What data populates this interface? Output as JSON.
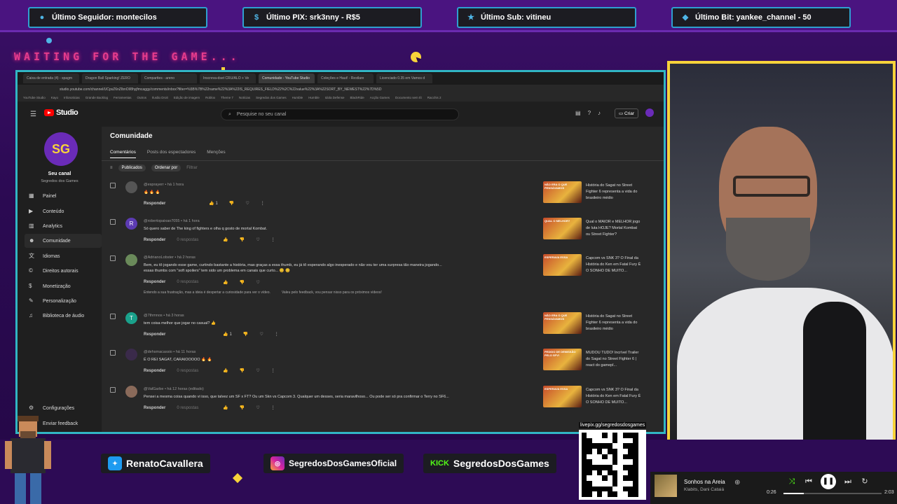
{
  "alerts": {
    "follower": "Último Seguidor: montecilos",
    "pix": "Último PIX: srk3nny - R$5",
    "sub": "Último Sub: vitineu",
    "bit": "Último Bit: yankee_channel - 50"
  },
  "waiting_text": "WAITING FOR THE GAME...",
  "browser": {
    "tabs": [
      "Caixa de entrada (4) - spagm",
      "Dragon Ball Sparking! ZERO",
      "Comparttes - areno",
      "Inscreva-dset CRU/ALO + Ve",
      "Comunidade - YouTube Studio",
      "Coleções e Haut! - Restlare",
      "Licenciado 0.35 em Vamos d"
    ],
    "url": "studio.youtube.com/channel/UCpsZ6nZIbnOl/8hyjfmcaggy/comments/inbox?filter=%5B%7B%22name%22%3A%22IS_REQUIRES_FIELD%22%2C%22value%22%3A%22SORT_BY_NEWEST%22%7D%5D",
    "bookmarks": [
      "YouTube Studio",
      "Kayo",
      "Infonoticias",
      "Grande Backlog",
      "Ferramentas",
      "Outros",
      "Ilusão Droit",
      "Edição de imagem",
      "Roblox",
      "Theme 7",
      "Notícias",
      "Segredos dos Games",
      "Humble",
      "Humble",
      "Idola Defense",
      "BlackRide",
      "Acção Games",
      "Documento sem tít",
      "Racchis 2"
    ]
  },
  "studio": {
    "logo_text": "Studio",
    "search_placeholder": "Pesquise no seu canal",
    "create_label": "Criar",
    "channel_name": "Seu canal",
    "channel_sub": "Segredos dos Games",
    "avatar_text": "SG",
    "nav": [
      "Painel",
      "Conteúdo",
      "Analytics",
      "Comunidade",
      "Idiomas",
      "Direitos autorais",
      "Monetização",
      "Personalização",
      "Biblioteca de áudio"
    ],
    "bottom_nav": [
      "Configurações",
      "Enviar feedback"
    ],
    "page_title": "Comunidade",
    "tabs": [
      "Comentários",
      "Posts dos espectadores",
      "Menções"
    ],
    "filters": {
      "published": "Publicados",
      "order": "Ordenar por",
      "filter": "Filtrar"
    }
  },
  "comments": [
    {
      "user": "@esprayerr",
      "time": "há 1 hora",
      "text": "🔥 🔥 🔥",
      "reply": "Responder",
      "replies": "",
      "likes": "1",
      "avatar": "",
      "video": "História do Sagat no Street Fighter 6 representa a vida do brasileiro médio"
    },
    {
      "user": "@robertopaixao7055",
      "time": "há 1 hora",
      "text": "Só quero saber de The king of fighters e olha q gosto de mortal Kombat.",
      "reply": "Responder",
      "replies": "0 respostas",
      "likes": "",
      "avatar": "R",
      "video": "Qual o MAIOR e MELHOR jogo de luta HOJE? Mortal Kombat ou Street Fighter?"
    },
    {
      "user": "@AdrianoLobster",
      "time": "há 2 horas",
      "text": "Bem, eu tô jogando esse game, curtindo bastante a história, mas graças a essa thumb, eu já tô esperando algo inesperado e não vou ter uma surpresa tão maneira jogando... essas thumbs com \"soft spoilers\" tem sido um problema em canais que curto... 😊 😊",
      "reply": "Responder",
      "replies": "0 respostas",
      "likes": "",
      "avatar": "",
      "video": "Capcom vs SNK 3? O Final da História do Ken em Fatal Fury É O SONHO DE MUITO..."
    },
    {
      "user": "@7thmnos",
      "time": "há 3 horas",
      "text": "tem coisa melhor que jogar no casual? 👍",
      "reply": "Responder",
      "replies": "",
      "likes": "1",
      "avatar": "T",
      "video": "História do Sagat no Street Fighter 6 representa a vida do brasileiro médio"
    },
    {
      "user": "@dehsmacassio",
      "time": "há 11 horas",
      "text": "É O REI SAGAT, CARAIOOOOO 🔥 🔥",
      "reply": "Responder",
      "replies": "0 respostas",
      "likes": "",
      "avatar": "",
      "video": "MUDOU TUDO! Incrível Trailer do Sagat no Street Fighter 6 | react do gamepl..."
    },
    {
      "user": "@ValGarbe",
      "time": "há 12 horas (editado)",
      "text": "Pensei a mesma coisa quando vi isso, que talvez um SF x FT? Ou um Skn vs Capcom 3. Qualquer um desses, seria maravilhoso... Ou pode ser só pra confirmar o Terry no SF6...",
      "reply": "Responder",
      "replies": "0 respostas",
      "likes": "",
      "avatar": "",
      "video": "Capcom vs SNK 3? O Final da História do Ken em Fatal Fury É O SONHO DE MUITO..."
    }
  ],
  "reply_thread": {
    "text": "Entendo a sua frustração, mas a ideia é despertar a curiosidade para ver o vídeo.",
    "reply": "Valeu pelo feedback, vou pensar nisso para os próximos vídeos!"
  },
  "thumb_texts": [
    "NÃO ERA O QUE PENSÁVAMOS",
    "QUAL O MELHOR?",
    "ESPERAVA ESSA",
    "NÃO ERA O QUE PENSÁVAMOS",
    "PEDIDO DE DEMISSÃO PELO SFV!",
    "ESPERAVA ESSA"
  ],
  "social": {
    "twitter": "RenatoCavallera",
    "instagram": "SegredosDosGamesOficial",
    "kick": "SegredosDosGames",
    "kick_logo": "KICK"
  },
  "livepix": "livepix.gg/segredosdosgames",
  "player": {
    "title": "Sonhos na Areia",
    "artist": "Klabits, Dani Cataiá",
    "elapsed": "0:26",
    "duration": "2:03",
    "progress": 0.21
  },
  "colors": {
    "accent_teal": "#31b6c4",
    "accent_yellow": "#f7d33a",
    "accent_pink": "#e43c8c",
    "youtube_red": "#ff0000"
  }
}
